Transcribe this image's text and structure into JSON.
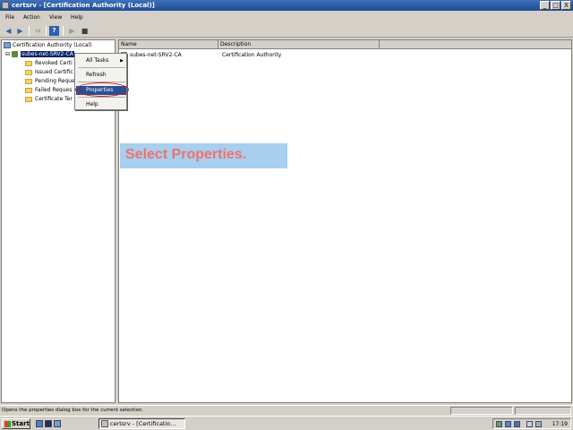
{
  "window": {
    "title": "certsrv - [Certification Authority (Local)]"
  },
  "window_controls": {
    "minimize": "_",
    "maximize": "□",
    "close": "X"
  },
  "menu": [
    "File",
    "Action",
    "View",
    "Help"
  ],
  "tree": {
    "root": "Certification Authority (Local)",
    "ca": "subes-net-SRV2-CA",
    "children": [
      "Revoked Certi",
      "Issued Certific",
      "Pending Reque",
      "Failed Reques",
      "Certificate Ter"
    ]
  },
  "list": {
    "columns": [
      "Name",
      "Description"
    ],
    "rows": [
      {
        "name": "subes-net-SRV2-CA",
        "description": "Certification Authority"
      }
    ]
  },
  "context_menu": {
    "items": [
      "All Tasks",
      "Refresh",
      "Properties",
      "Help"
    ],
    "highlighted": "Properties"
  },
  "callout": {
    "text": "Select Properties."
  },
  "status": {
    "text": "Opens the properties dialog box for the current selection."
  },
  "taskbar": {
    "start": "Start",
    "task": "certsrv - [Certificatio...",
    "clock": "17:19"
  },
  "colors": {
    "titlebar": "#1d4c97",
    "menu_highlight": "#2b4e93",
    "callout_bg": "#a8cfee",
    "callout_text": "#f07070",
    "ring": "#d02020"
  }
}
